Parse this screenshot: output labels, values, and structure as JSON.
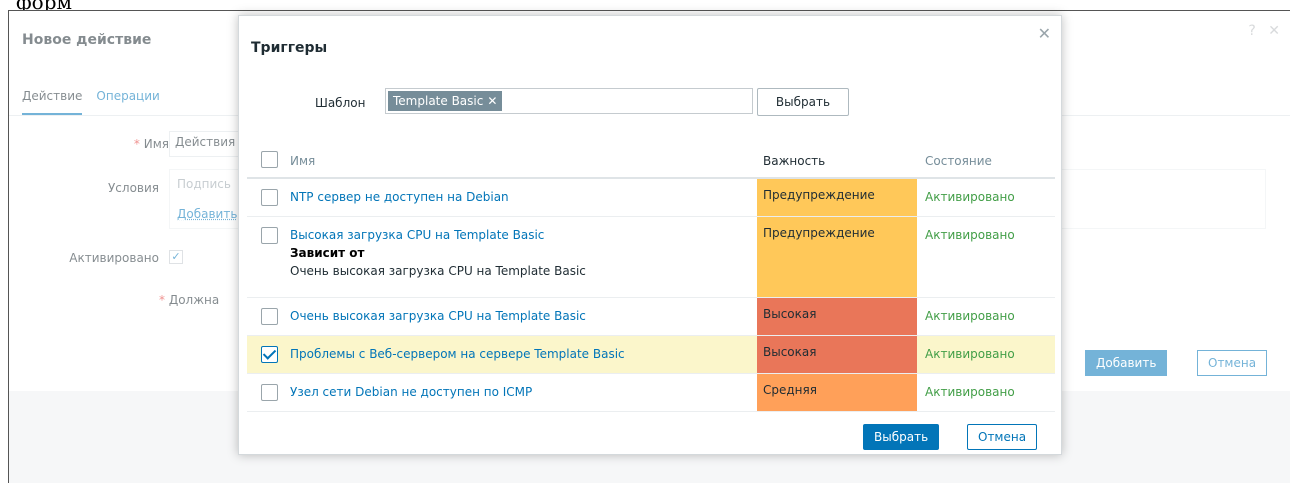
{
  "top_caption": "форм",
  "background": {
    "title": "Новое действие",
    "help_icon": "?",
    "close_icon": "✕",
    "tabs": [
      {
        "label": "Действие"
      },
      {
        "label": "Операции"
      }
    ],
    "name_label": "Имя",
    "name_value": "Действия",
    "conditions_label": "Условия",
    "conditions_header": "Подпись",
    "conditions_add": "Добавить",
    "enabled_label": "Активировано",
    "must_label": "Должна",
    "add_button": "Добавить",
    "cancel_button": "Отмена"
  },
  "modal": {
    "title": "Триггеры",
    "close": "✕",
    "template_label": "Шаблон",
    "template_chip": "Template Basic",
    "chip_remove": "✕",
    "select_template_button": "Выбрать",
    "columns": {
      "name": "Имя",
      "severity": "Важность",
      "status": "Состояние"
    },
    "rows": [
      {
        "name": "NTP сервер не доступен на Debian",
        "severity": "Предупреждение",
        "status": "Активировано",
        "checked": false
      },
      {
        "name": "Высокая загрузка CPU на Template Basic",
        "depends_title": "Зависит от",
        "depends_item": "Очень высокая загрузка CPU на Template Basic",
        "severity": "Предупреждение",
        "status": "Активировано",
        "checked": false
      },
      {
        "name": "Очень высокая загрузка CPU на Template Basic",
        "severity": "Высокая",
        "status": "Активировано",
        "checked": false
      },
      {
        "name": "Проблемы с Веб-сервером на сервере Template Basic",
        "severity": "Высокая",
        "status": "Активировано",
        "checked": true
      },
      {
        "name": "Узел сети Debian не доступен по ICMP",
        "severity": "Средняя",
        "status": "Активировано",
        "checked": false
      }
    ],
    "select_button": "Выбрать",
    "cancel_button": "Отмена"
  },
  "colors": {
    "accent": "#0275b8",
    "warning": "#ffc859",
    "high": "#e97659",
    "average": "#ffa059",
    "enabled": "#429e47",
    "selected_row": "#fbf6cb"
  }
}
